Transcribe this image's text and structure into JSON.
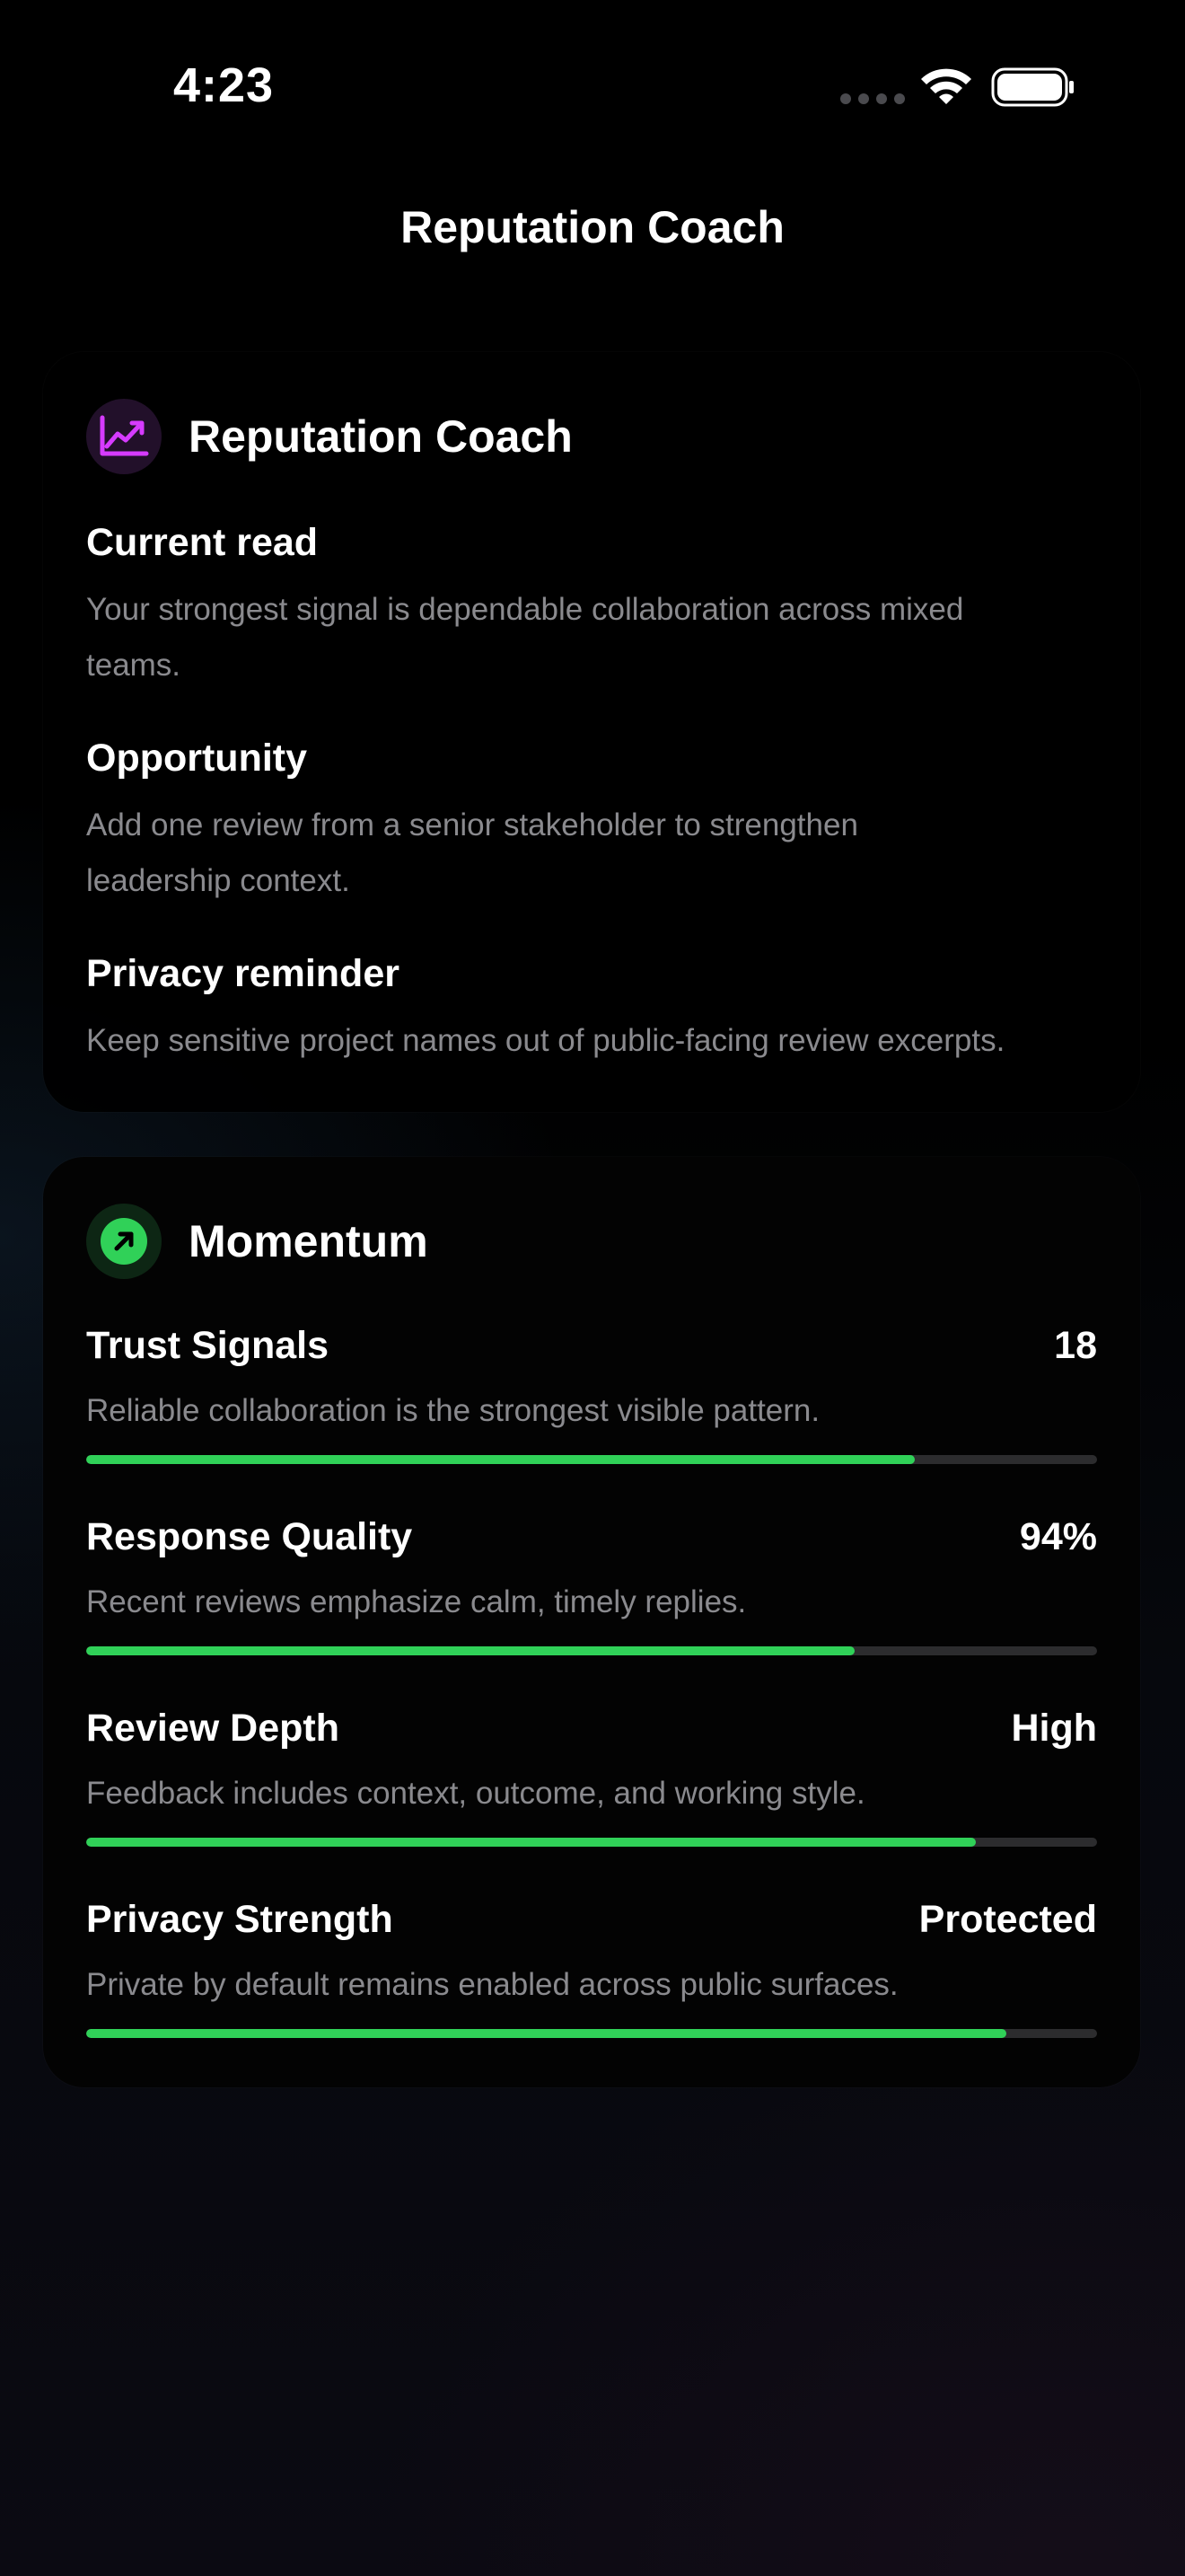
{
  "status_bar": {
    "time": "4:23",
    "icons": [
      "cellular-icon",
      "wifi-icon",
      "battery-icon"
    ]
  },
  "nav": {
    "title": "Reputation Coach"
  },
  "coach_card": {
    "title": "Reputation Coach",
    "icon": "chart-line-icon",
    "accent_color": "#d63bff",
    "sections": [
      {
        "heading": "Current read",
        "text": "Your strongest signal is dependable collaboration across mixed teams."
      },
      {
        "heading": "Opportunity",
        "text": "Add one review from a senior stakeholder to strengthen leadership context."
      },
      {
        "heading": "Privacy reminder",
        "text": "Keep sensitive project names out of public-facing review excerpts."
      }
    ]
  },
  "momentum_card": {
    "title": "Momentum",
    "icon": "arrow-up-right-icon",
    "accent_color": "#30d158",
    "metrics": [
      {
        "label": "Trust Signals",
        "value": "18",
        "description": "Reliable collaboration is the strongest visible pattern.",
        "progress": 0.82
      },
      {
        "label": "Response Quality",
        "value": "94%",
        "description": "Recent reviews emphasize calm, timely replies.",
        "progress": 0.76
      },
      {
        "label": "Review Depth",
        "value": "High",
        "description": "Feedback includes context, outcome, and working style.",
        "progress": 0.88
      },
      {
        "label": "Privacy Strength",
        "value": "Protected",
        "description": "Private by default remains enabled across public surfaces.",
        "progress": 0.91
      }
    ]
  }
}
